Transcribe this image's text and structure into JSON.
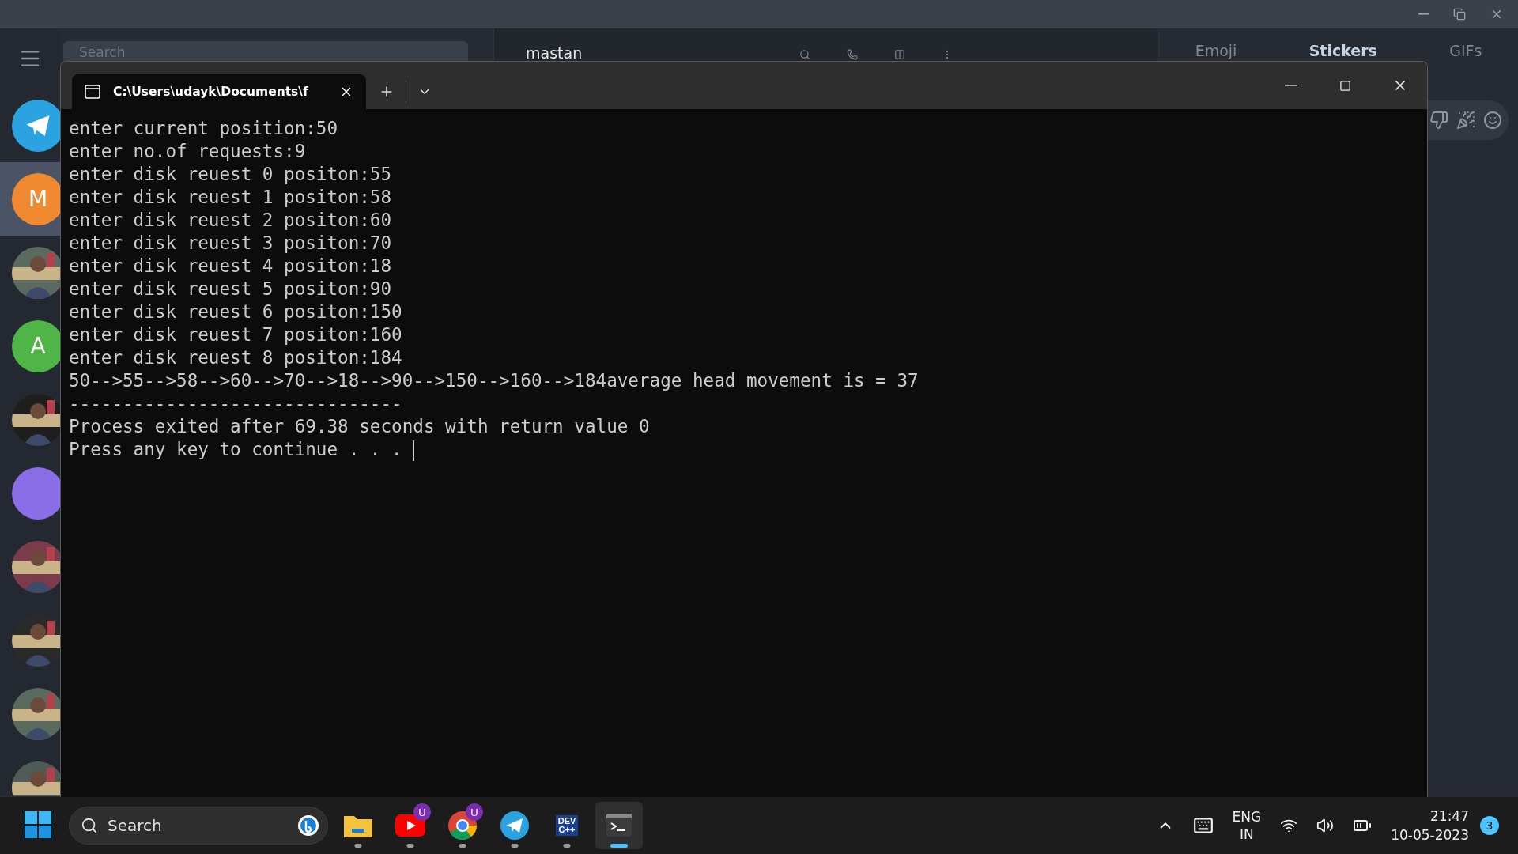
{
  "telegram": {
    "search": {
      "placeholder": "Search"
    },
    "chat_title": "mastan",
    "chats": [
      {
        "kind": "logo",
        "selected": false
      },
      {
        "kind": "letter",
        "letter": "M",
        "color": "#f0892f",
        "selected": true
      },
      {
        "kind": "picture",
        "selected": false
      },
      {
        "kind": "letter",
        "letter": "A",
        "color": "#4fb547",
        "selected": false
      },
      {
        "kind": "picture",
        "selected": false
      },
      {
        "kind": "blank",
        "color": "#8a6ee8",
        "selected": false
      },
      {
        "kind": "picture",
        "selected": false
      },
      {
        "kind": "picture",
        "selected": false
      },
      {
        "kind": "picture",
        "selected": false
      },
      {
        "kind": "picture",
        "selected": false
      }
    ],
    "panel_tabs": [
      {
        "label": "Emoji",
        "selected": false
      },
      {
        "label": "Stickers",
        "selected": true
      },
      {
        "label": "GIFs",
        "selected": false
      }
    ]
  },
  "terminal": {
    "tab_title": "C:\\Users\\udayk\\Documents\\f",
    "lines": [
      "enter current position:50",
      "enter no.of requests:9",
      "enter disk reuest 0 positon:55",
      "enter disk reuest 1 positon:58",
      "enter disk reuest 2 positon:60",
      "enter disk reuest 3 positon:70",
      "enter disk reuest 4 positon:18",
      "enter disk reuest 5 positon:90",
      "enter disk reuest 6 positon:150",
      "enter disk reuest 7 positon:160",
      "enter disk reuest 8 positon:184",
      "50-->55-->58-->60-->70-->18-->90-->150-->160-->184average head movement is = 37",
      "-------------------------------",
      "Process exited after 69.38 seconds with return value 0",
      "Press any key to continue . . . "
    ]
  },
  "taskbar": {
    "search": {
      "placeholder": "Search"
    },
    "apps": [
      {
        "kind": "explorer",
        "active": false
      },
      {
        "kind": "youtube",
        "badge": "U",
        "active": false
      },
      {
        "kind": "chrome",
        "badge": "U",
        "active": false
      },
      {
        "kind": "telegram",
        "active": false
      },
      {
        "kind": "devcpp",
        "logo_text": [
          "DEV",
          "C++"
        ],
        "active": false
      },
      {
        "kind": "terminal",
        "active": true
      }
    ],
    "language": "ENG",
    "region": "IN",
    "time": "21:47",
    "date": "10-05-2023",
    "notifications": "3"
  }
}
